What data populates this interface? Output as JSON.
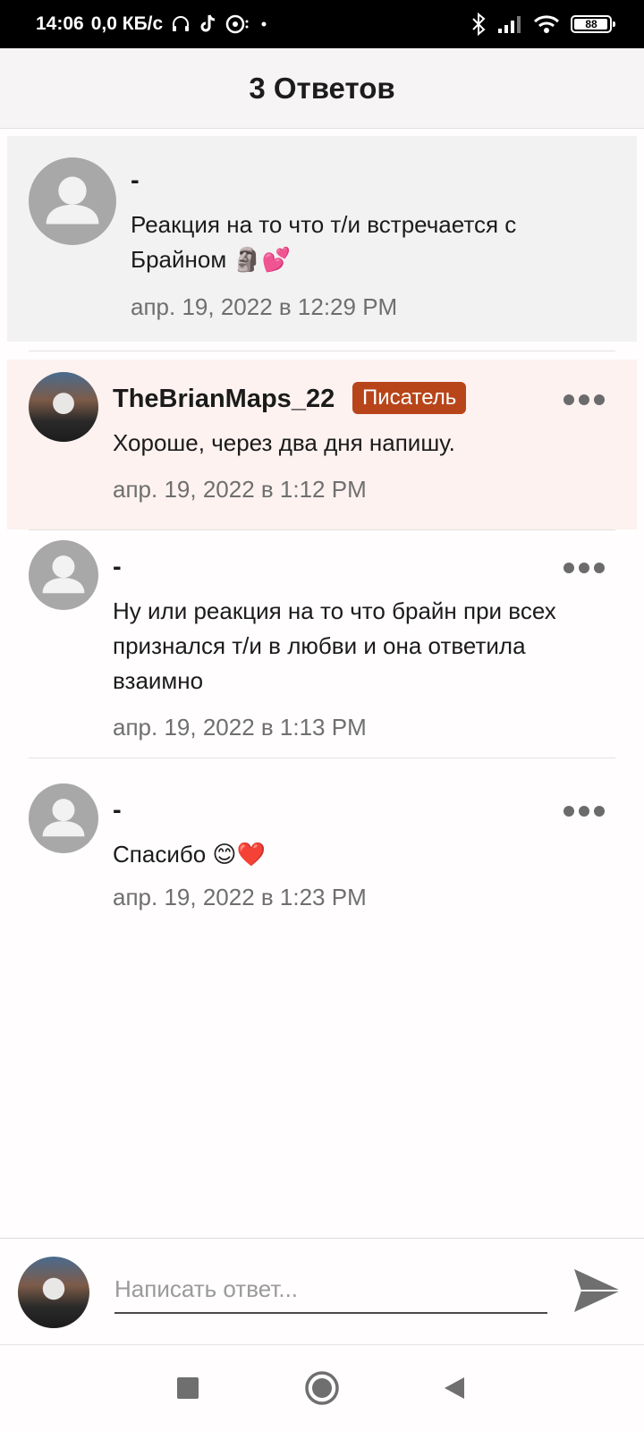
{
  "status_bar": {
    "time": "14:06",
    "speed": "0,0 КБ/с",
    "battery": "88"
  },
  "header": {
    "title": "3 Ответов"
  },
  "comments": [
    {
      "author": "-",
      "text": "Реакция на то что т/и встречается с Брайном 🗿💕",
      "time": "апр. 19, 2022 в 12:29 PM"
    },
    {
      "author": "TheBrianMaps_22",
      "badge": "Писатель",
      "text": "Хороше, через два дня напишу.",
      "time": "апр. 19, 2022 в 1:12 PM"
    },
    {
      "author": "-",
      "text": "Ну или реакция на то что брайн при всех признался т/и в любви и она ответила взаимно",
      "time": "апр. 19, 2022 в 1:13 PM"
    },
    {
      "author": "-",
      "text": "Спасибо 😊❤️",
      "time": "апр. 19, 2022 в 1:23 PM"
    }
  ],
  "reply": {
    "placeholder": "Написать ответ..."
  },
  "colors": {
    "badge": "#b8451a",
    "highlight": "#fdf2f0",
    "header_bg": "#f6f4f4"
  }
}
